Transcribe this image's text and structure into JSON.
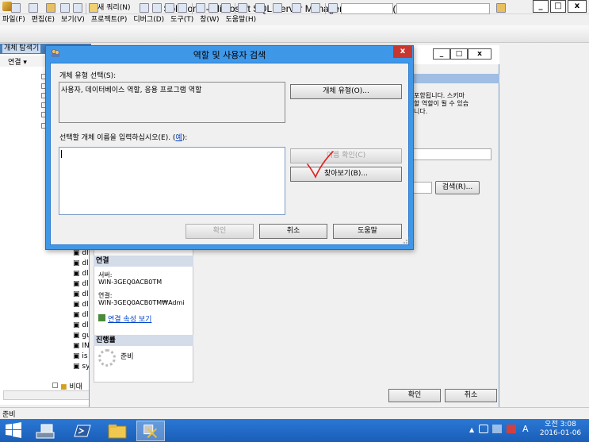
{
  "app": {
    "title": "Solution1 - Microsoft SQL Server Management Studio (관리자)",
    "min_label": "_",
    "max_label": "□",
    "close_label": "x"
  },
  "menu": [
    "파일(F)",
    "편집(E)",
    "보기(V)",
    "프로젝트(P)",
    "디버그(D)",
    "도구(T)",
    "창(W)",
    "도움말(H)"
  ],
  "toolbar": {
    "new_query_label": "새 쿼리(N)"
  },
  "object_explorer": {
    "tab_label": "개체 탐색기",
    "connect_label": "연결 ▾",
    "tree_prefix_items": [
      "dl",
      "dl",
      "dl",
      "dl",
      "dl",
      "dl",
      "dl",
      "dl",
      "gu",
      "IN",
      "is",
      "sy"
    ],
    "folder_label": "비대"
  },
  "login_window": {
    "min_label": "_",
    "max_label": "□",
    "close_label": "x",
    "description_line1": "포함됩니다. 스키마",
    "description_line2": "할 역할이 될 수 있습",
    "description_line3": "니다.",
    "search_button": "검색(R)...",
    "connection_section": "연결",
    "server_label": "서버:",
    "server_value": "WIN-3GEQ0ACB0TM",
    "connection_label": "연결:",
    "connection_value": "WIN-3GEQ0ACB0TM₩Admi",
    "view_props_link": "연결 속성 보기",
    "progress_section": "진행률",
    "progress_status": "준비",
    "ok_button": "확인",
    "cancel_button": "취소"
  },
  "dialog": {
    "title": "역할 및 사용자 검색",
    "close_label": "x",
    "object_type_label": "개체 유형 선택(S):",
    "object_type_value": "사용자, 데이터베이스 역할, 응용 프로그램 역할",
    "object_type_button": "개체 유형(O)...",
    "enter_names_label": "선택할 개체 이름을 입력하십시오(E). (",
    "enter_names_link": "예",
    "enter_names_suffix": "):",
    "check_names_button": "이름 확인(C)",
    "browse_button": "찾아보기(B)...",
    "ok_button": "확인",
    "cancel_button": "취소",
    "help_button": "도움말"
  },
  "status_bar": {
    "text": "준비"
  },
  "taskbar": {
    "time": "오전 3:08",
    "date": "2016-01-06",
    "tray_lang": "A"
  },
  "colors": {
    "dialog_frame": "#3f97e8",
    "close_red": "#c7372f",
    "taskbar": "#1a5eb8",
    "annotation_red": "#e02020"
  }
}
